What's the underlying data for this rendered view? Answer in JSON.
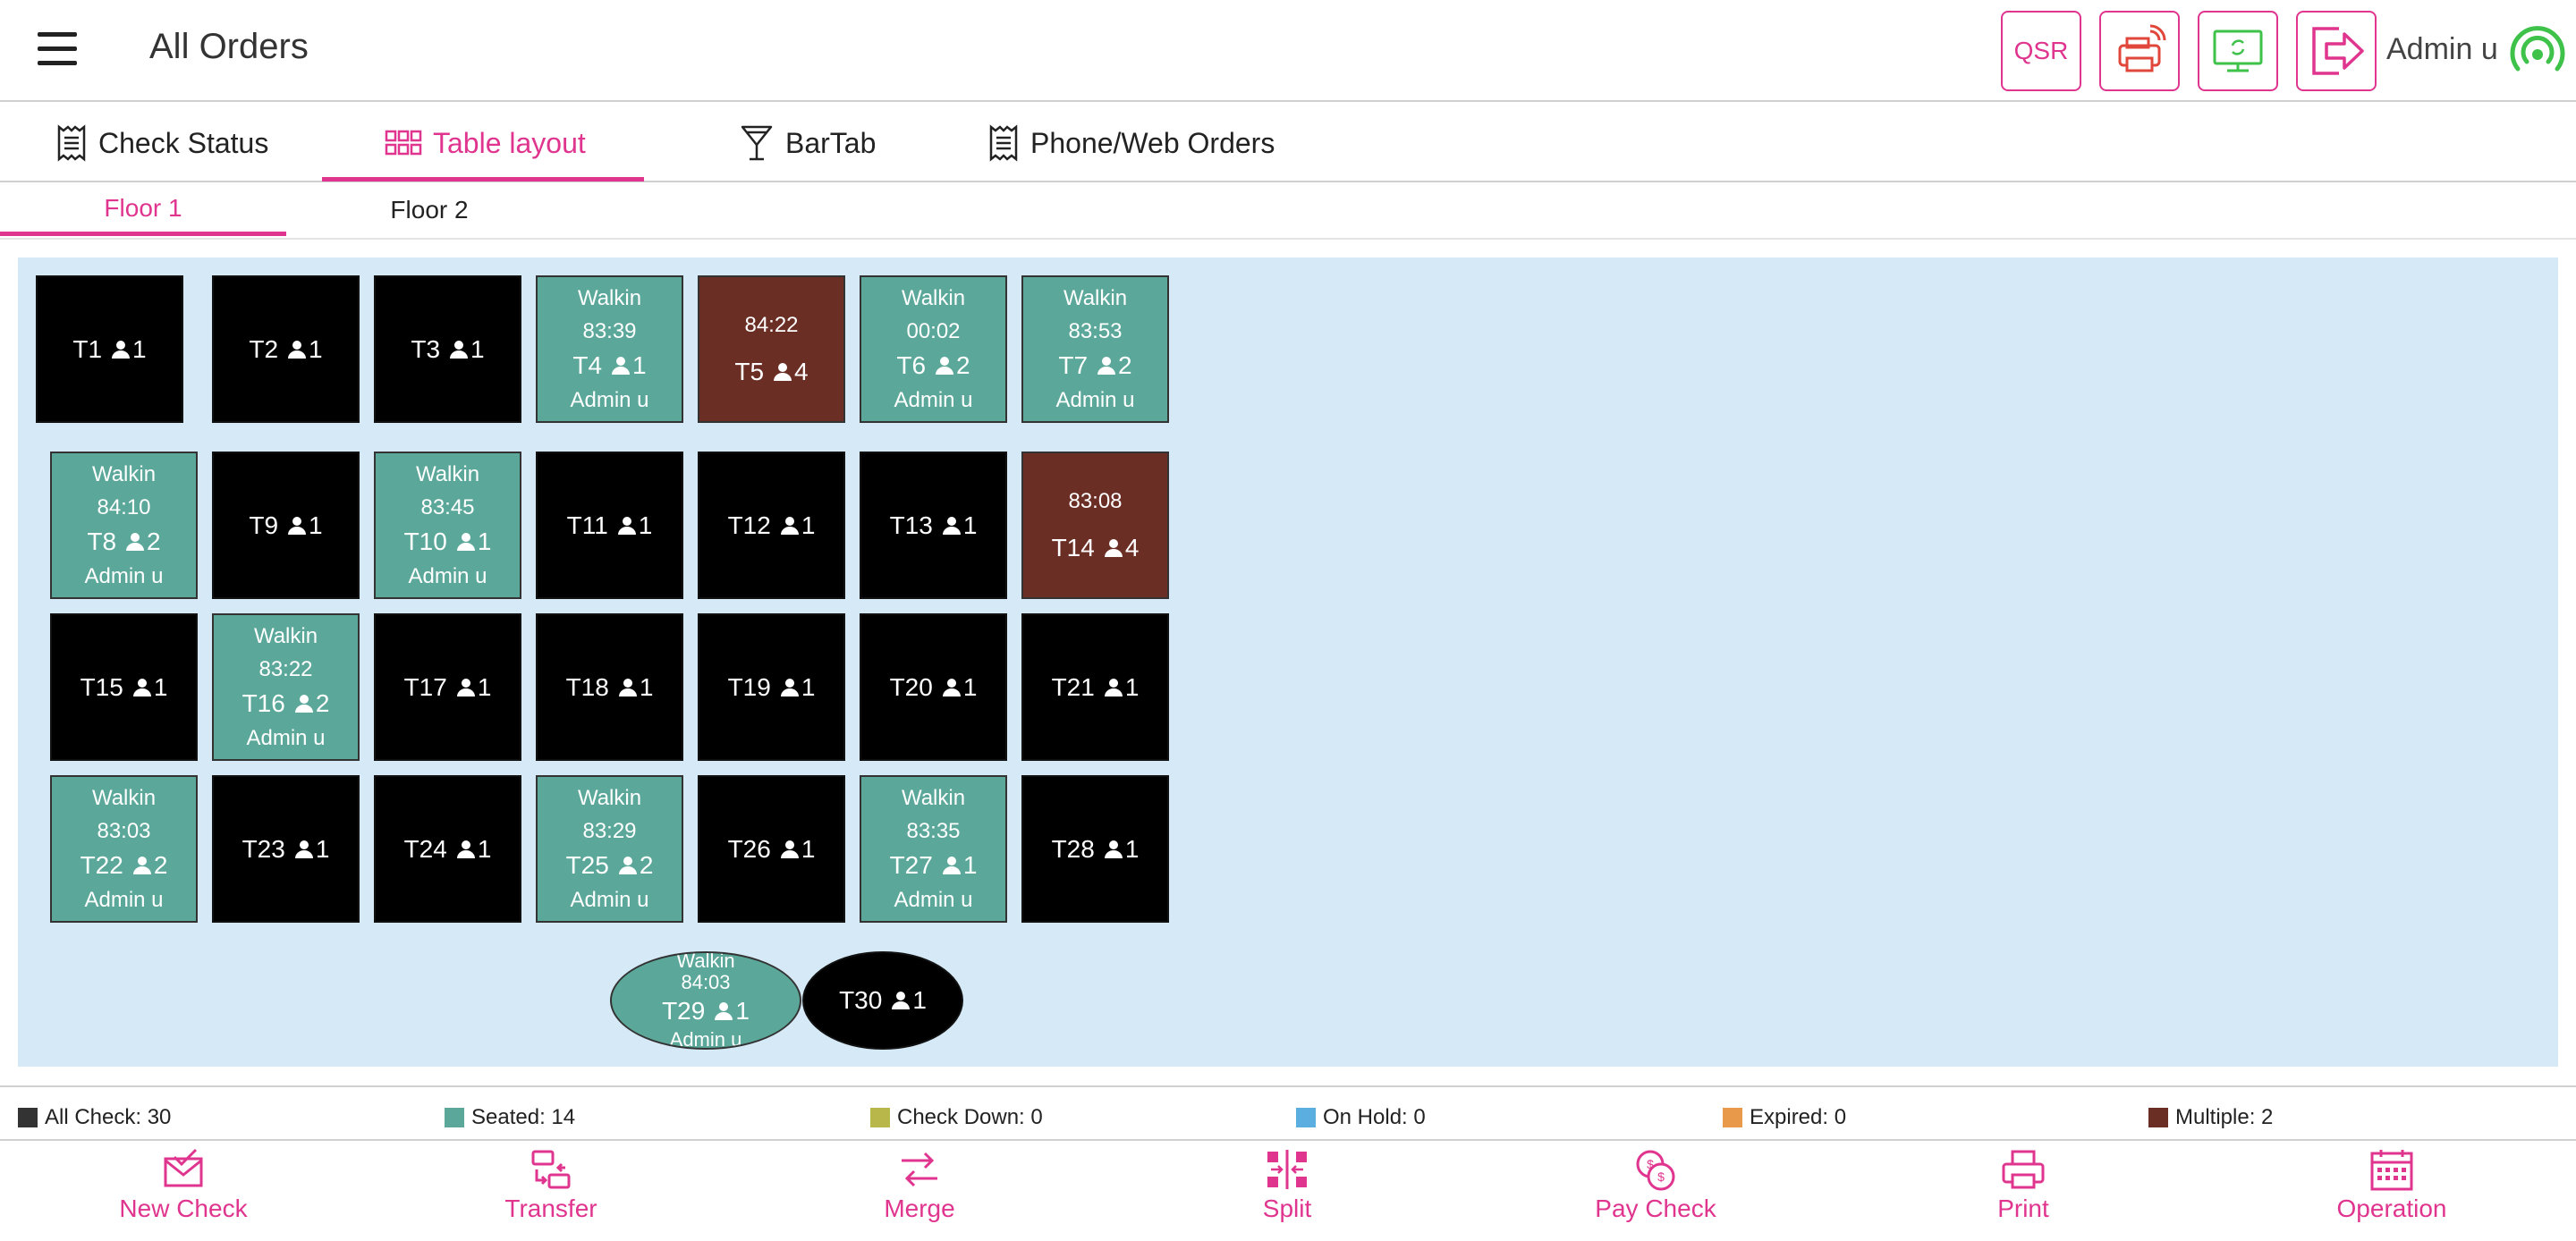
{
  "header": {
    "title": "All Orders",
    "qsr_label": "QSR",
    "user_name": "Admin u"
  },
  "tabs": [
    {
      "label": "Check Status",
      "icon": "receipt-icon"
    },
    {
      "label": "Table layout",
      "icon": "grid-icon",
      "active": true
    },
    {
      "label": "BarTab",
      "icon": "cocktail-icon"
    },
    {
      "label": "Phone/Web Orders",
      "icon": "receipt-icon"
    }
  ],
  "floors": [
    {
      "label": "Floor 1",
      "active": true
    },
    {
      "label": "Floor 2"
    }
  ],
  "tables": [
    {
      "id": "T1",
      "guests": "1",
      "status": "free"
    },
    {
      "id": "T2",
      "guests": "1",
      "status": "free"
    },
    {
      "id": "T3",
      "guests": "1",
      "status": "free"
    },
    {
      "id": "T4",
      "guests": "1",
      "status": "seated",
      "name": "Walkin",
      "time": "83:39",
      "server": "Admin u"
    },
    {
      "id": "T5",
      "guests": "4",
      "status": "multiple",
      "time": "84:22"
    },
    {
      "id": "T6",
      "guests": "2",
      "status": "seated",
      "name": "Walkin",
      "time": "00:02",
      "server": "Admin u"
    },
    {
      "id": "T7",
      "guests": "2",
      "status": "seated",
      "name": "Walkin",
      "time": "83:53",
      "server": "Admin u"
    },
    {
      "id": "T8",
      "guests": "2",
      "status": "seated",
      "name": "Walkin",
      "time": "84:10",
      "server": "Admin u"
    },
    {
      "id": "T9",
      "guests": "1",
      "status": "free"
    },
    {
      "id": "T10",
      "guests": "1",
      "status": "seated",
      "name": "Walkin",
      "time": "83:45",
      "server": "Admin u"
    },
    {
      "id": "T11",
      "guests": "1",
      "status": "free"
    },
    {
      "id": "T12",
      "guests": "1",
      "status": "free"
    },
    {
      "id": "T13",
      "guests": "1",
      "status": "free"
    },
    {
      "id": "T14",
      "guests": "4",
      "status": "multiple",
      "time": "83:08"
    },
    {
      "id": "T15",
      "guests": "1",
      "status": "free"
    },
    {
      "id": "T16",
      "guests": "2",
      "status": "seated",
      "name": "Walkin",
      "time": "83:22",
      "server": "Admin u"
    },
    {
      "id": "T17",
      "guests": "1",
      "status": "free"
    },
    {
      "id": "T18",
      "guests": "1",
      "status": "free"
    },
    {
      "id": "T19",
      "guests": "1",
      "status": "free"
    },
    {
      "id": "T20",
      "guests": "1",
      "status": "free"
    },
    {
      "id": "T21",
      "guests": "1",
      "status": "free"
    },
    {
      "id": "T22",
      "guests": "2",
      "status": "seated",
      "name": "Walkin",
      "time": "83:03",
      "server": "Admin u"
    },
    {
      "id": "T23",
      "guests": "1",
      "status": "free"
    },
    {
      "id": "T24",
      "guests": "1",
      "status": "free"
    },
    {
      "id": "T25",
      "guests": "2",
      "status": "seated",
      "name": "Walkin",
      "time": "83:29",
      "server": "Admin u"
    },
    {
      "id": "T26",
      "guests": "1",
      "status": "free"
    },
    {
      "id": "T27",
      "guests": "1",
      "status": "seated",
      "name": "Walkin",
      "time": "83:35",
      "server": "Admin u"
    },
    {
      "id": "T28",
      "guests": "1",
      "status": "free"
    },
    {
      "id": "T29",
      "guests": "1",
      "status": "seated",
      "shape": "oval",
      "name": "Walkin",
      "time": "84:03",
      "server": "Admin u"
    },
    {
      "id": "T30",
      "guests": "1",
      "status": "free",
      "shape": "oval"
    }
  ],
  "legend": [
    {
      "label": "All Check: 30",
      "color": "#333333"
    },
    {
      "label": "Seated: 14",
      "color": "#5ba89a"
    },
    {
      "label": "Check Down: 0",
      "color": "#b8b84a"
    },
    {
      "label": "On Hold: 0",
      "color": "#5aaee0"
    },
    {
      "label": "Expired: 0",
      "color": "#e89a4a"
    },
    {
      "label": "Multiple: 2",
      "color": "#6b2e25"
    }
  ],
  "actions": [
    {
      "label": "New Check",
      "icon": "new-check-icon"
    },
    {
      "label": "Transfer",
      "icon": "transfer-icon"
    },
    {
      "label": "Merge",
      "icon": "merge-icon"
    },
    {
      "label": "Split",
      "icon": "split-icon"
    },
    {
      "label": "Pay Check",
      "icon": "pay-check-icon"
    },
    {
      "label": "Print",
      "icon": "print-icon"
    },
    {
      "label": "Operation",
      "icon": "calendar-icon"
    }
  ],
  "colors": {
    "accent": "#e0358f",
    "seated": "#5ba89a",
    "multiple": "#6b2e25",
    "free": "#000000",
    "canvas": "#d5e9f6"
  }
}
